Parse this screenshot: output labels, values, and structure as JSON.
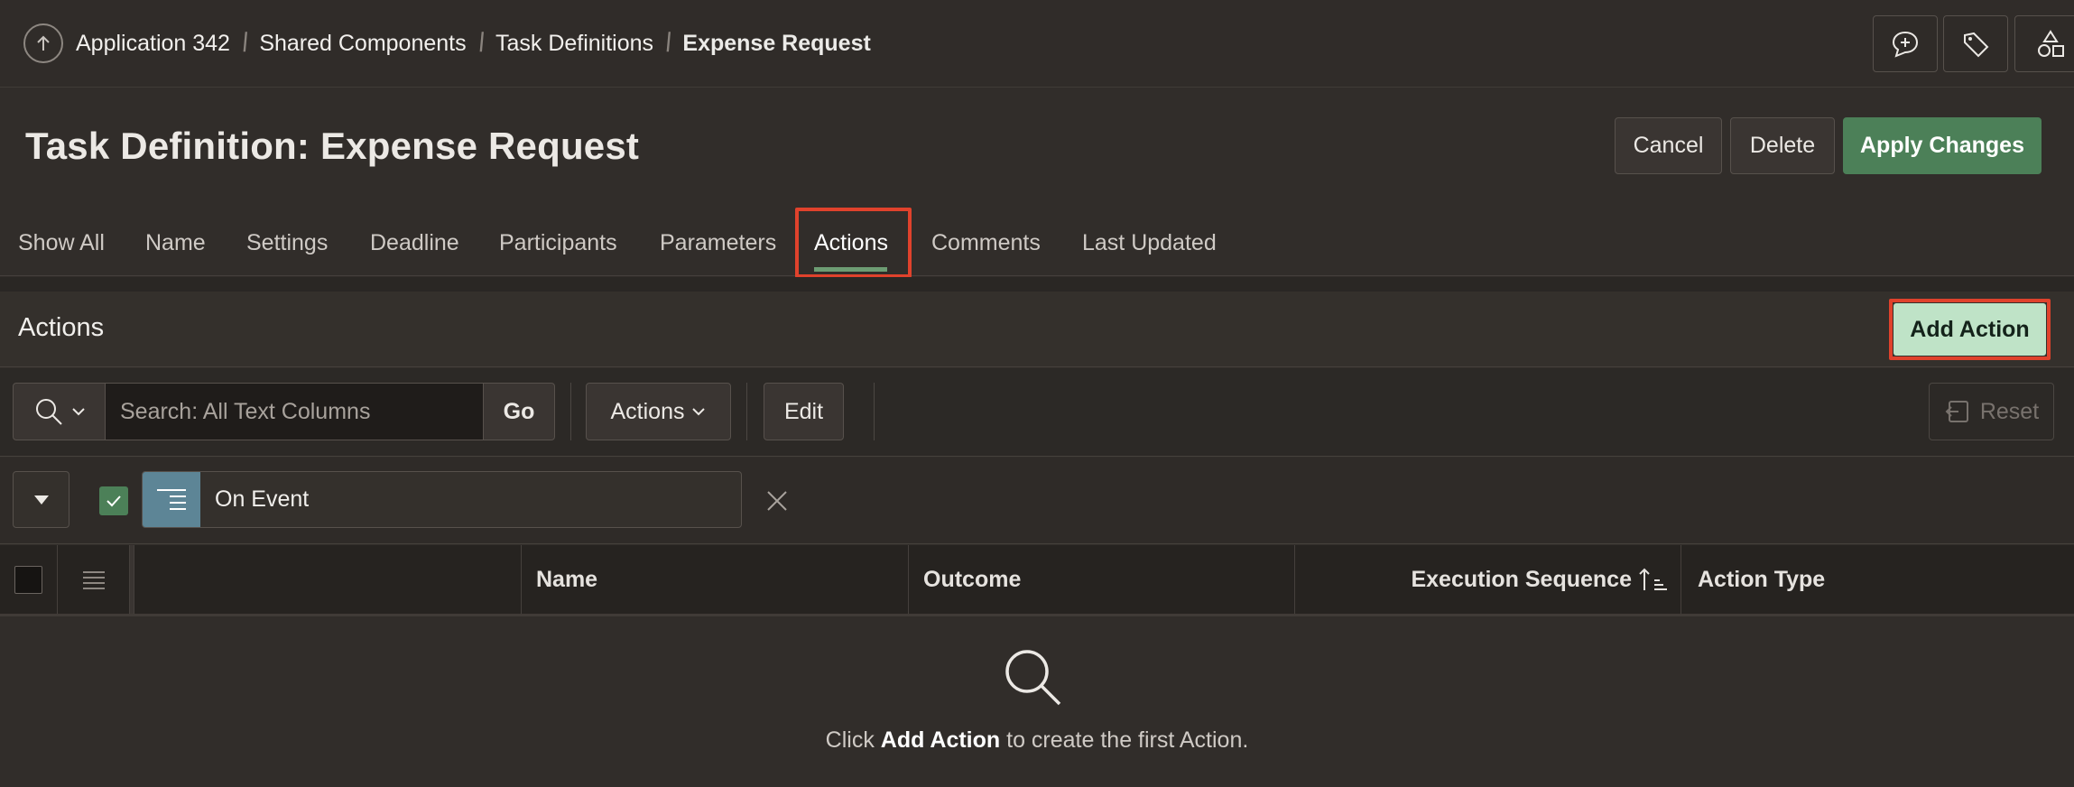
{
  "breadcrumb": {
    "items": [
      "Application 342",
      "Shared Components",
      "Task Definitions"
    ],
    "current": "Expense Request"
  },
  "header_tools": [
    "add-comment-icon",
    "tag-icon",
    "shapes-icon"
  ],
  "page": {
    "title": "Task Definition: Expense Request"
  },
  "buttons": {
    "cancel": "Cancel",
    "delete": "Delete",
    "apply": "Apply Changes"
  },
  "tabs": [
    "Show All",
    "Name",
    "Settings",
    "Deadline",
    "Participants",
    "Parameters",
    "Actions",
    "Comments",
    "Last Updated"
  ],
  "active_tab": "Actions",
  "region": {
    "title": "Actions",
    "add_button": "Add Action"
  },
  "toolbar": {
    "search_placeholder": "Search: All Text Columns",
    "go": "Go",
    "actions_menu": "Actions",
    "edit": "Edit",
    "reset": "Reset"
  },
  "filter": {
    "label": "On Event",
    "enabled": true
  },
  "grid": {
    "columns": [
      "Name",
      "Outcome",
      "Execution Sequence",
      "Action Type"
    ],
    "sorted_column": "Execution Sequence",
    "sort_direction": "ascending"
  },
  "empty_message": {
    "prefix": "Click ",
    "emphasis": "Add Action",
    "suffix": " to create the first Action."
  },
  "colors": {
    "background": "#312d2a",
    "primary": "#4c8058",
    "add_action": "#bfe3c7",
    "highlight": "#e0422c",
    "filter_icon": "#5d8596"
  }
}
